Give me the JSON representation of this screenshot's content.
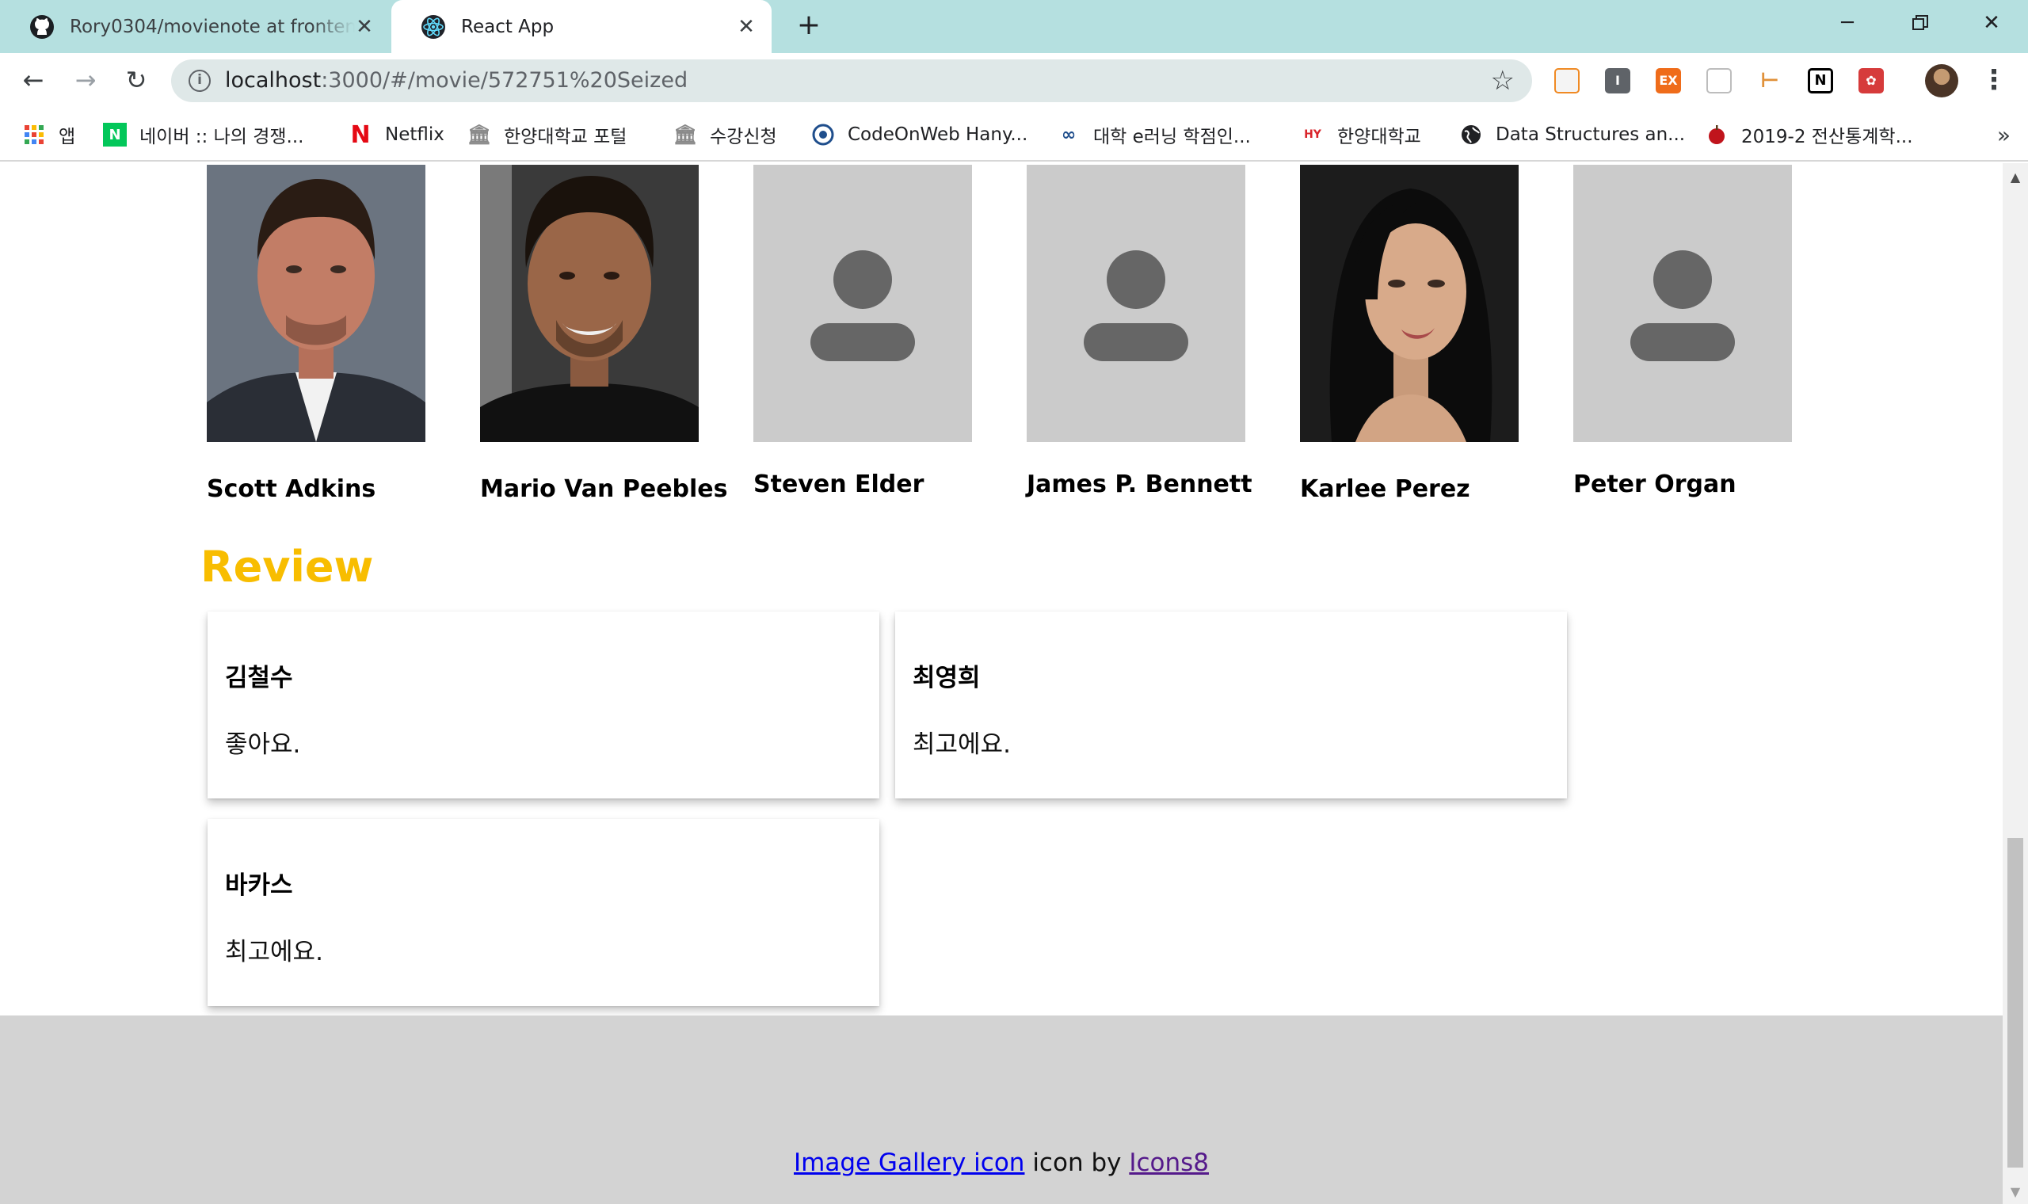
{
  "browser": {
    "tabs": [
      {
        "title": "Rory0304/movienote at frontend",
        "active": false
      },
      {
        "title": "React App",
        "active": true
      }
    ],
    "url_host": "localhost",
    "url_rest": ":3000/#/movie/572751%20Seized",
    "bookmarks": [
      {
        "label": "앱",
        "icon": "apps-grid-icon"
      },
      {
        "label": "네이버 :: 나의 경쟁...",
        "icon": "naver-icon"
      },
      {
        "label": "Netflix",
        "icon": "netflix-icon"
      },
      {
        "label": "한양대학교 포털",
        "icon": "building-icon"
      },
      {
        "label": "수강신청",
        "icon": "building-icon"
      },
      {
        "label": "CodeOnWeb Hany...",
        "icon": "codeonweb-icon"
      },
      {
        "label": "대학 e러닝 학점인...",
        "icon": "elearning-icon"
      },
      {
        "label": "한양대학교",
        "icon": "hanyang-icon"
      },
      {
        "label": "Data Structures an...",
        "icon": "globe-icon"
      },
      {
        "label": "2019-2 전산통계학...",
        "icon": "apple-icon"
      }
    ],
    "bookmarks_more": "»"
  },
  "cast": [
    {
      "name": "Scott Adkins",
      "has_photo": true
    },
    {
      "name": "Mario Van Peebles",
      "has_photo": true
    },
    {
      "name": "Steven Elder",
      "has_photo": false
    },
    {
      "name": "James P. Bennett",
      "has_photo": false
    },
    {
      "name": "Karlee Perez",
      "has_photo": true
    },
    {
      "name": "Peter Organ",
      "has_photo": false
    }
  ],
  "review": {
    "heading": "Review",
    "heading_color": "#f8bd00",
    "items": [
      {
        "author": "김철수",
        "text": "좋아요."
      },
      {
        "author": "최영희",
        "text": "최고에요."
      },
      {
        "author": "바카스",
        "text": "최고에요."
      }
    ]
  },
  "footer": {
    "link1": "Image Gallery icon",
    "middle": " icon by ",
    "link2": "Icons8"
  }
}
